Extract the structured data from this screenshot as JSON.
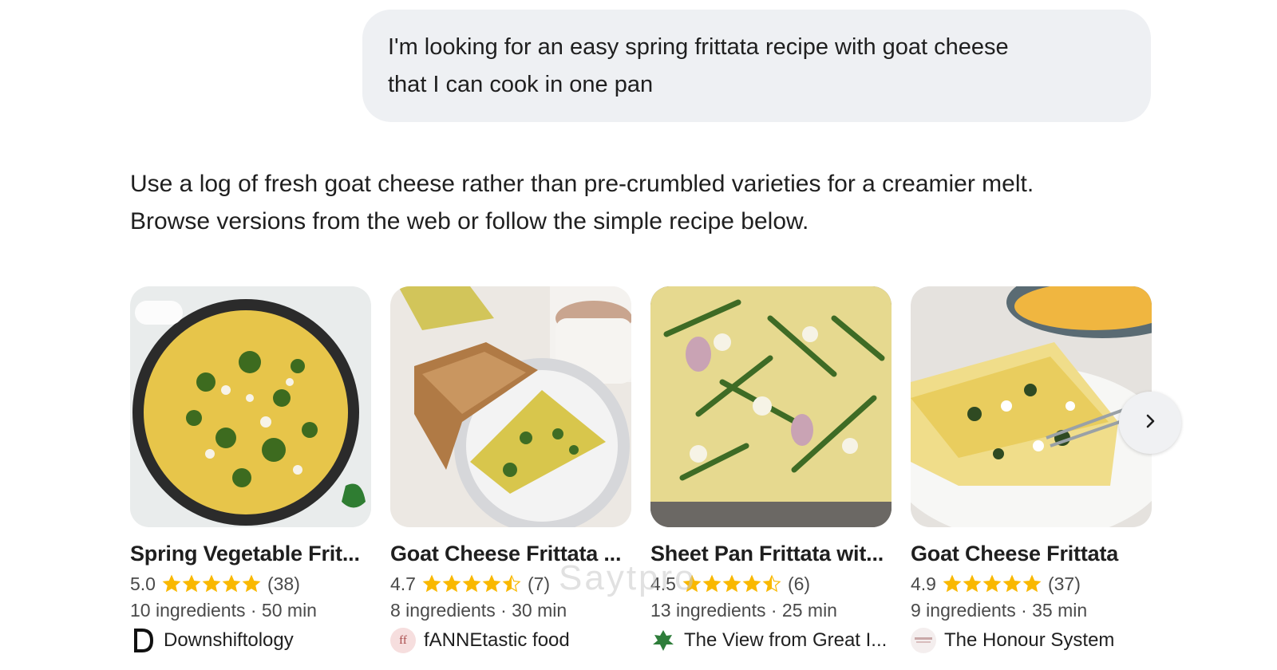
{
  "user_message": {
    "line1": "I'm looking for an easy spring frittata recipe with goat cheese",
    "line2": "that I can cook in one pan"
  },
  "answer": {
    "line1": "Use a log of fresh goat cheese rather than pre-crumbled varieties for a creamier melt.",
    "line2": "Browse versions from the web or follow the simple recipe below."
  },
  "colors": {
    "star": "#f9b800",
    "bubble": "#eef0f3",
    "text": "#1f1f1f",
    "muted": "#4a4a4a"
  },
  "cards": [
    {
      "title": "Spring Vegetable Frit...",
      "rating": "5.0",
      "stars": 5,
      "reviews": "(38)",
      "meta": "10 ingredients · 50 min",
      "source": "Downshiftology",
      "source_icon": "downshiftology-logo"
    },
    {
      "title": "Goat Cheese Frittata ...",
      "rating": "4.7",
      "stars": 4.5,
      "reviews": "(7)",
      "meta": "8 ingredients · 30 min",
      "source": "fANNEtastic food",
      "source_icon": "fannetastic-logo",
      "source_mark": "ff"
    },
    {
      "title": "Sheet Pan Frittata wit...",
      "rating": "4.5",
      "stars": 4.5,
      "reviews": "(6)",
      "meta": "13 ingredients · 25 min",
      "source": "The View from Great I...",
      "source_icon": "leaf-logo"
    },
    {
      "title": "Goat Cheese Frittata",
      "rating": "4.9",
      "stars": 5,
      "reviews": "(37)",
      "meta": "9 ingredients · 35 min",
      "source": "The Honour System",
      "source_icon": "honour-system-logo"
    }
  ],
  "carousel": {
    "next_icon": "chevron-right-icon"
  },
  "watermark": "Saytpro"
}
